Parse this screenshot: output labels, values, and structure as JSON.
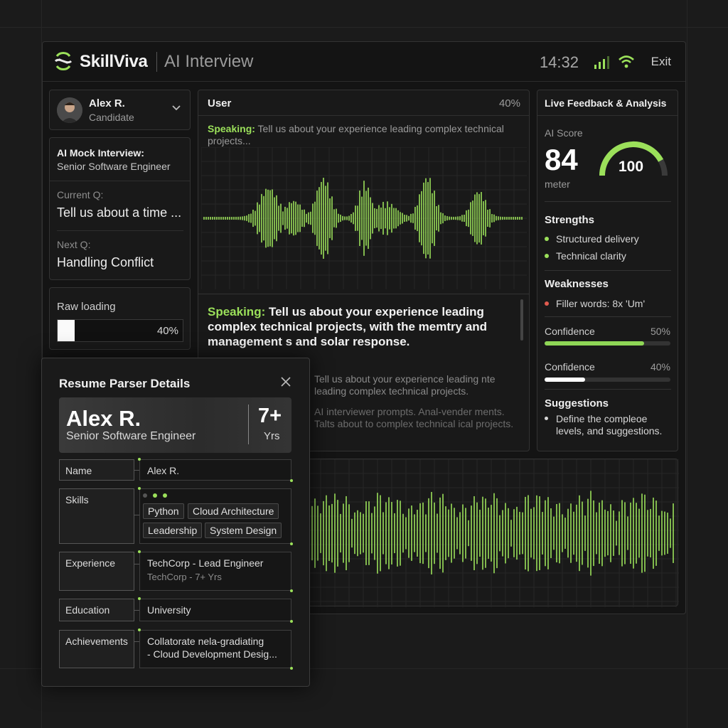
{
  "header": {
    "brand": "SkillViva",
    "product": "AI Interview",
    "time": "14:32",
    "exit_label": "Exit",
    "accent": "#9be05a"
  },
  "candidate": {
    "name": "Alex R.",
    "role": "Candidate"
  },
  "interview": {
    "title": "AI Mock Interview:",
    "subtitle": "Senior Software Engineer",
    "current_label": "Current Q:",
    "current_value": "Tell us about a time ...",
    "next_label": "Next Q:",
    "next_value": "Handling Conflict"
  },
  "raw_loading": {
    "label": "Raw loading",
    "percent_text": "40%",
    "fraction": 0.4
  },
  "transcript": {
    "title": "User",
    "percent_text": "40%",
    "speaking_tag": "Speaking:",
    "speaking_short": "Tell us about your experience leading complex technical projects...",
    "speaking_main": "Tell us about your experience leading complex technical projects, with the memtry and management s and solar response.",
    "faded_1": "Tell us about your experience leading nte leading complex technical projects.",
    "faded_2": "AI interviewer prompts. Anal-vender ments. Talts about to complex technical ical projects."
  },
  "feedback": {
    "title": "Live Feedback & Analysis",
    "score_label": "AI Score",
    "score": "84",
    "gauge_max": "100",
    "gauge_fraction": 0.84,
    "meter_label": "meter",
    "strengths_title": "Strengths",
    "strengths": [
      "Structured delivery",
      "Technical clarity"
    ],
    "weaknesses_title": "Weaknesses",
    "weaknesses": [
      "Filler words: 8x 'Um'"
    ],
    "confidence": [
      {
        "label": "Confidence",
        "percent_text": "50%",
        "fraction": 0.79,
        "color": "#8fd656"
      },
      {
        "label": "Confidence",
        "percent_text": "40%",
        "fraction": 0.32,
        "color": "#ffffff"
      }
    ],
    "suggestions_title": "Suggestions",
    "suggestions": "Define the compleoe levels, and suggestions.",
    "weak_color": "#e05a4e"
  },
  "resume": {
    "title": "Resume Parser Details",
    "name": "Alex R.",
    "role": "Senior Software Engineer",
    "years": "7+",
    "years_label": "Yrs",
    "fields": {
      "name_label": "Name",
      "name_value": "Alex R.",
      "skills_label": "Skills",
      "skills": [
        "Python",
        "Cloud Architecture",
        "Leadership",
        "System Design"
      ],
      "experience_label": "Experience",
      "experience_title": "TechCorp - Lead Engineer",
      "experience_sub": "TechCorp   -  7+ Yrs",
      "education_label": "Education",
      "education_value": "University",
      "achievements_label": "Achievements",
      "achievement_1": "Collatorate nela-gradiating",
      "achievement_2": "-   Cloud Development Desig..."
    }
  }
}
